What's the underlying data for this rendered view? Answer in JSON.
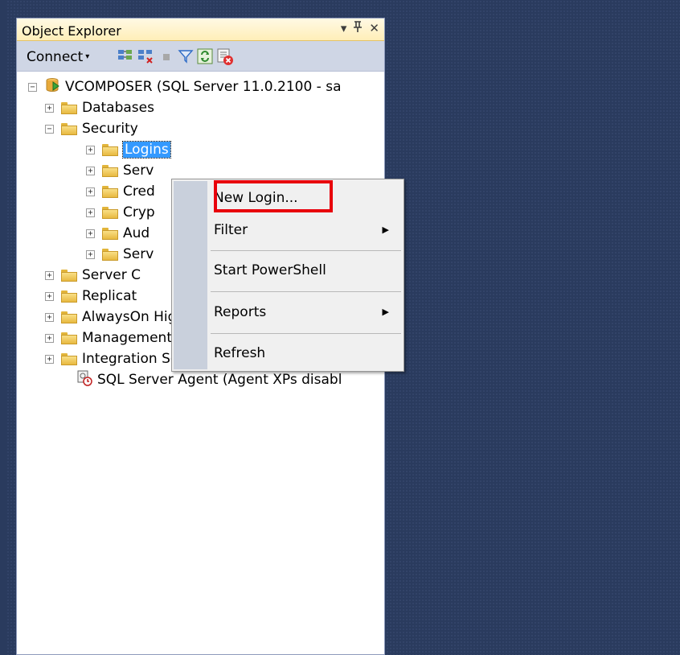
{
  "panel": {
    "title": "Object Explorer",
    "title_icons": {
      "dropdown": "▾",
      "pin": "ꟼ",
      "close": "✕"
    }
  },
  "toolbar": {
    "connect_label": "Connect",
    "connect_caret": "▾"
  },
  "tree": {
    "server": "VCOMPOSER (SQL Server 11.0.2100 - sa",
    "databases": "Databases",
    "security": "Security",
    "logins": "Logins",
    "server_roles_partial": "Serv",
    "credentials_partial": "Cred",
    "cryptographic_partial": "Cryp",
    "audits_partial": "Aud",
    "server_audit_spec_partial": "Serv",
    "server_objects_partial": "Server C",
    "replication_partial": "Replicat",
    "alwayson": "AlwaysOn High Availability",
    "management": "Management",
    "integration_services": "Integration Services Catalogs",
    "sql_agent": "SQL Server Agent (Agent XPs disabl",
    "expander_plus": "+",
    "expander_minus": "−"
  },
  "context_menu": {
    "new_login": "New Login...",
    "filter": "Filter",
    "start_powershell": "Start PowerShell",
    "reports": "Reports",
    "refresh": "Refresh",
    "submenu_arrow": "▶"
  },
  "colors": {
    "highlight": "#e8000b",
    "selection": "#3399ff",
    "workspace": "#2a3b5e"
  }
}
